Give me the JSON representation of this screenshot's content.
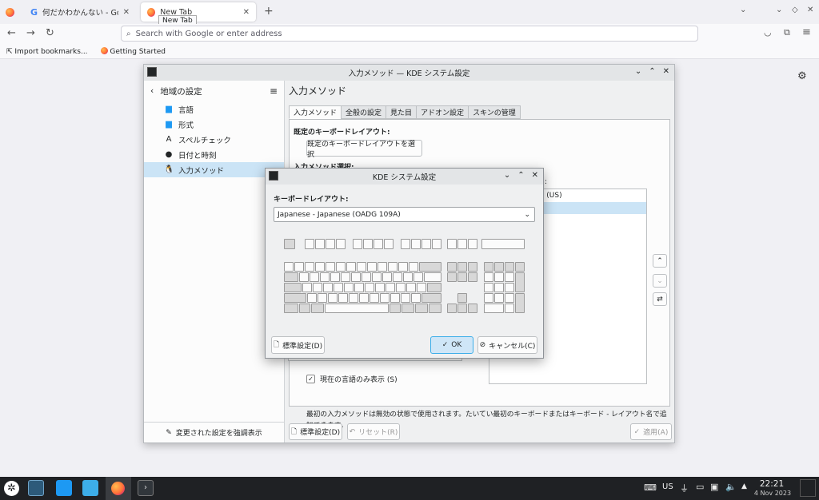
{
  "browser": {
    "tabs": [
      {
        "label": "何だかわかんない - Google"
      },
      {
        "label": "New Tab"
      }
    ],
    "tooltip": "New Tab",
    "url_placeholder": "Search with Google or enter address",
    "bookmarks": [
      {
        "label": "Import bookmarks..."
      },
      {
        "label": "Getting Started"
      }
    ]
  },
  "kde": {
    "title": "入力メソッド — KDE システム設定",
    "sidebar_header": "地域の設定",
    "sidebar_items": [
      {
        "label": "言語",
        "icon": "speech-bubble-icon"
      },
      {
        "label": "形式",
        "icon": "speech-bubble-icon"
      },
      {
        "label": "スペルチェック",
        "icon": "spell-icon"
      },
      {
        "label": "日付と時刻",
        "icon": "clock-icon"
      },
      {
        "label": "入力メソッド",
        "icon": "penguin-icon"
      }
    ],
    "highlight_changed": "変更された設定を強調表示",
    "page_title": "入力メソッド",
    "tabs": [
      "入力メソッド",
      "全般の設定",
      "見た目",
      "アドオン設定",
      "スキンの管理"
    ],
    "default_layout_label": "既定のキーボードレイアウト:",
    "choose_layout_button": "既定のキーボードレイアウトを選択",
    "im_select_label": "入力メソッド選択:",
    "available_label_fragment": "ド:",
    "list_item_fragment": "sh (US)",
    "only_current_lang": "現在の言語のみ表示 (S)",
    "info_text": "最初の入力メソッドは無効の状態で使用されます。たいてい最初のキーボードまたはキーボード - レイアウト名で追加できます。",
    "defaults_button": "標準設定(D)",
    "reset_button": "リセット(R)",
    "apply_button": "適用(A)"
  },
  "dialog": {
    "title": "KDE システム設定",
    "layout_label": "キーボードレイアウト:",
    "layout_value": "Japanese - Japanese (OADG 109A)",
    "defaults_button": "標準設定(D)",
    "ok_button": "OK",
    "cancel_button": "キャンセル(C)"
  },
  "taskbar": {
    "keyboard_layout": "US",
    "time": "22:21",
    "date": "4 Nov 2023"
  }
}
